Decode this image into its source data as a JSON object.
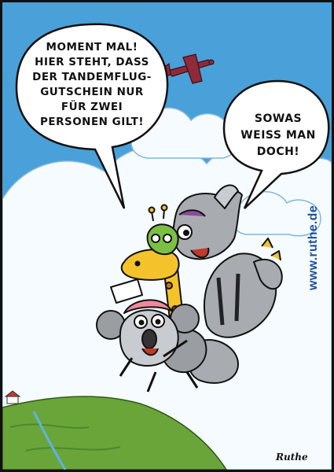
{
  "comic": {
    "speech_left": {
      "lines": [
        "MOMENT MAL!",
        "HIER STEHT, DASS",
        "DER TANDEMFLUG-",
        "GUTSCHEIN NUR",
        "FÜR ZWEI",
        "PERSONEN GILT!"
      ]
    },
    "speech_right": {
      "lines": [
        "SOWAS",
        "WEISS MAN",
        "DOCH!"
      ]
    },
    "website": "www.ruthe.de",
    "signature": "Ruthe"
  },
  "colors": {
    "sky": "#4aa0d8",
    "cloud": "#f6fbff",
    "cloud_outline": "#7fb7dd",
    "plane": "#8f2a3b",
    "grass": "#6aa53a",
    "url": "#1d4f9c",
    "rhino": "#a8acb0",
    "giraffe": "#f4c22a",
    "koala": "#9a9ea3",
    "helmet_pink": "#f08a9a",
    "helmet_green": "#7bc043",
    "helmet_purple": "#8a4a9a"
  },
  "icons": [
    "airplane-icon"
  ]
}
